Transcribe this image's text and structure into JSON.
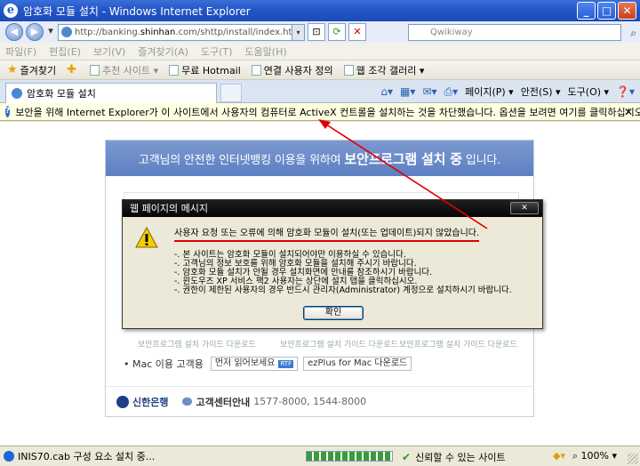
{
  "window": {
    "title": "암호화 모듈 설치 - Windows Internet Explorer",
    "min": "_",
    "max": "□",
    "close": "✕"
  },
  "address": {
    "url_prefix": "http://banking.",
    "url_host": "shinhan",
    "url_rest": ".com/shttp/install/index.html?url=",
    "search_placeholder": "Qwikiway"
  },
  "menu": {
    "items": [
      "파일(F)",
      "편집(E)",
      "보기(V)",
      "즐겨찾기(A)",
      "도구(T)",
      "도움말(H)"
    ]
  },
  "favorites": {
    "favorites_label": "즐겨찾기",
    "items": [
      "추천 사이트 ▾",
      "무료 Hotmail",
      "연결 사용자 정의",
      "웹 조각 갤러리 ▾"
    ]
  },
  "tabs": {
    "active_tab": "암호화 모듈 설치",
    "page_label": "페이지(P) ▾",
    "safety_label": "안전(S) ▾",
    "tools_label": "도구(O) ▾",
    "help_label": "❓▾"
  },
  "infobar": {
    "message": "보안을 위해 Internet Explorer가 이 사이트에서 사용자의 컴퓨터로 ActiveX 컨트롤을 설치하는 것을 차단했습니다. 옵션을 보려면 여기를 클릭하십시오.",
    "close": "✕"
  },
  "page": {
    "header_text": "고객님의 안전한 인터넷뱅킹 이용을 위하여",
    "header_bold": "보안프로그램 설치 중",
    "header_tail": "입니다.",
    "bg_row": [
      "보안프로그램 설치 가이드 다운로드",
      "보안프로그램 설치 가이드 다운로드",
      "보안프로그램 설치 가이드 다운로드"
    ],
    "mac_label": "• Mac 이용 고객용",
    "mac_btn1": "먼저 읽어보세요",
    "mac_btn1_badge": "RTF",
    "mac_btn2": "ezPlus for Mac 다운로드",
    "bank_name": "신한은행",
    "cc_label": "고객센터안내",
    "cc_numbers": "1577-8000, 1544-8000"
  },
  "dialog": {
    "title": "웹 페이지의 메시지",
    "close": "✕",
    "main": "사용자 요청 또는 오류에 의해 암호화 모듈이 설치(또는 업데이트)되지 않았습니다.",
    "lines": [
      "-. 본 사이트는 암호화 모듈이 설치되어야만 이용하실 수 있습니다.",
      "-. 고객님의 정보 보호를 위해 암호화 모듈을 설치해 주시기 바랍니다.",
      "-. 암호화 모듈 설치가 안될 경우 설치화면에 안내를 참조하시기 바랍니다.",
      "-. 윈도우즈 XP 서비스 팩2 사용자는 상단에 설치 탭을 클릭하십시오.",
      "-. 권한이 제한된 사용자의 경우 반드시 관리자(Administrator) 계정으로 설치하시기 바랍니다."
    ],
    "ok": "확인"
  },
  "status": {
    "text": "INIS70.cab 구성 요소 설치 중...",
    "trusted": "신뢰할 수 있는 사이트",
    "zoom": "100%",
    "progress": 1.0
  }
}
